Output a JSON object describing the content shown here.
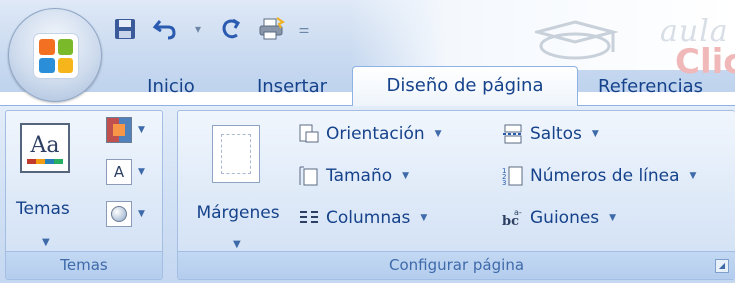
{
  "ribbon": {
    "tabs": [
      {
        "label": "Inicio"
      },
      {
        "label": "Insertar"
      },
      {
        "label": "Diseño de página"
      },
      {
        "label": "Referencias"
      }
    ],
    "groups": {
      "temas": {
        "label": "Temas",
        "button_label": "Temas"
      },
      "configurar": {
        "label": "Configurar página",
        "margenes_label": "Márgenes",
        "orientacion_label": "Orientación",
        "tamano_label": "Tamaño",
        "columnas_label": "Columnas",
        "saltos_label": "Saltos",
        "numeros_label": "Números de línea",
        "guiones_label": "Guiones"
      }
    }
  },
  "watermark": {
    "text1": "aula",
    "text2": "Clic"
  },
  "colors": {
    "accent": "#15428b",
    "ribbon_bg": "#d3e2f5",
    "active_tab": "#ffffff"
  }
}
